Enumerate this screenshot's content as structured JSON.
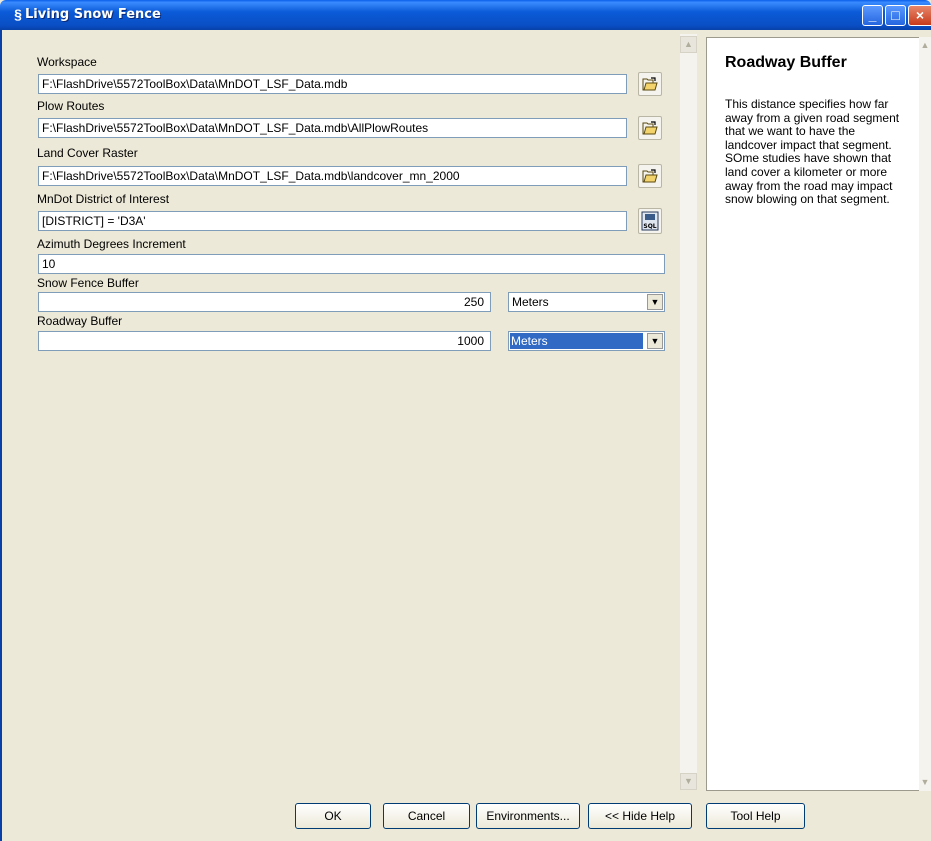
{
  "window": {
    "title": "Living Snow Fence",
    "icon": "script-icon"
  },
  "form": {
    "workspace": {
      "label": "Workspace",
      "value": "F:\\FlashDrive\\5572ToolBox\\Data\\MnDOT_LSF_Data.mdb"
    },
    "plow_routes": {
      "label": "Plow Routes",
      "value": "F:\\FlashDrive\\5572ToolBox\\Data\\MnDOT_LSF_Data.mdb\\AllPlowRoutes"
    },
    "land_cover": {
      "label": "Land Cover Raster",
      "value": "F:\\FlashDrive\\5572ToolBox\\Data\\MnDOT_LSF_Data.mdb\\landcover_mn_2000"
    },
    "district": {
      "label": "MnDot District of Interest",
      "value": "[DISTRICT] = 'D3A'"
    },
    "azimuth": {
      "label": "Azimuth Degrees Increment",
      "value": "10"
    },
    "snow_fence_buffer": {
      "label": "Snow Fence Buffer",
      "value": "250",
      "unit": "Meters"
    },
    "roadway_buffer": {
      "label": "Roadway Buffer",
      "value": "1000",
      "unit": "Meters"
    }
  },
  "help": {
    "title": "Roadway Buffer",
    "body": "This distance specifies how far away from a given road segment that we want to have the landcover impact that segment. SOme studies have shown that land cover a kilometer or more away from the road may impact snow blowing on that segment."
  },
  "buttons": {
    "ok": "OK",
    "cancel": "Cancel",
    "environments": "Environments...",
    "hide_help": "<< Hide Help",
    "tool_help": "Tool Help"
  },
  "colors": {
    "titlebar": "#0a4ec4",
    "selection": "#316ac5",
    "dialog_bg": "#ece9d8"
  }
}
